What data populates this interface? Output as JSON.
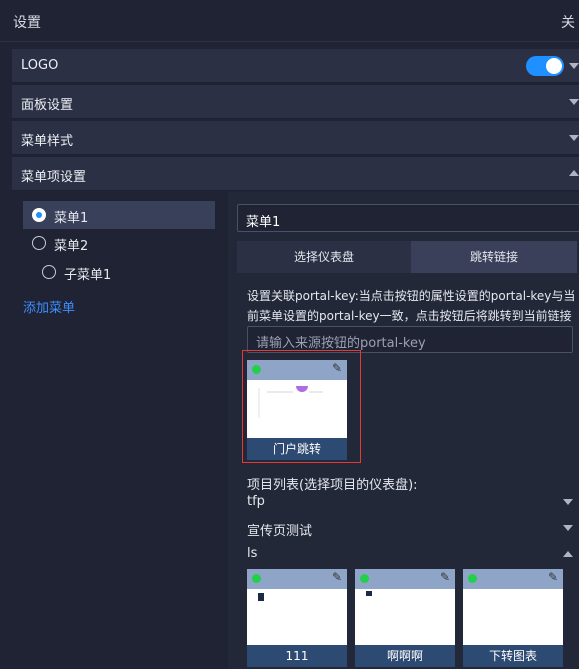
{
  "header": {
    "title": "设置",
    "close_label": "关"
  },
  "sections": [
    {
      "label": "LOGO",
      "toggle_on": true
    },
    {
      "label": "面板设置",
      "expanded": false
    },
    {
      "label": "菜单样式",
      "expanded": false
    },
    {
      "label": "菜单项设置",
      "expanded": true
    }
  ],
  "menu": {
    "items": [
      {
        "label": "菜单1",
        "checked": true
      },
      {
        "label": "菜单2",
        "checked": false
      },
      {
        "label": "子菜单1",
        "checked": false
      }
    ],
    "add_label": "添加菜单"
  },
  "editor": {
    "name_value": "菜单1",
    "tabs": [
      {
        "label": "选择仪表盘",
        "active": true
      },
      {
        "label": "跳转链接",
        "active": false
      }
    ],
    "description": "设置关联portal-key:当点击按钮的属性设置的portal-key与当前菜单设置的portal-key一致，点击按钮后将跳转到当前链接",
    "source_placeholder": "请输入来源按钮的portal-key",
    "selected_card": {
      "label": "门户跳转"
    },
    "projects_title": "项目列表(选择项目的仪表盘):",
    "projects": [
      {
        "name": "tfp",
        "expanded": false
      },
      {
        "name": "宣传页测试",
        "expanded": false
      },
      {
        "name": "ls",
        "expanded": true
      }
    ],
    "dashboards": [
      {
        "label": "111"
      },
      {
        "label": "啊啊啊"
      },
      {
        "label": "下转图表"
      }
    ]
  },
  "colors": {
    "accent": "#1e90ff",
    "selection_border": "#e53935",
    "status_dot": "#22d04b",
    "link": "#3d8eff"
  }
}
